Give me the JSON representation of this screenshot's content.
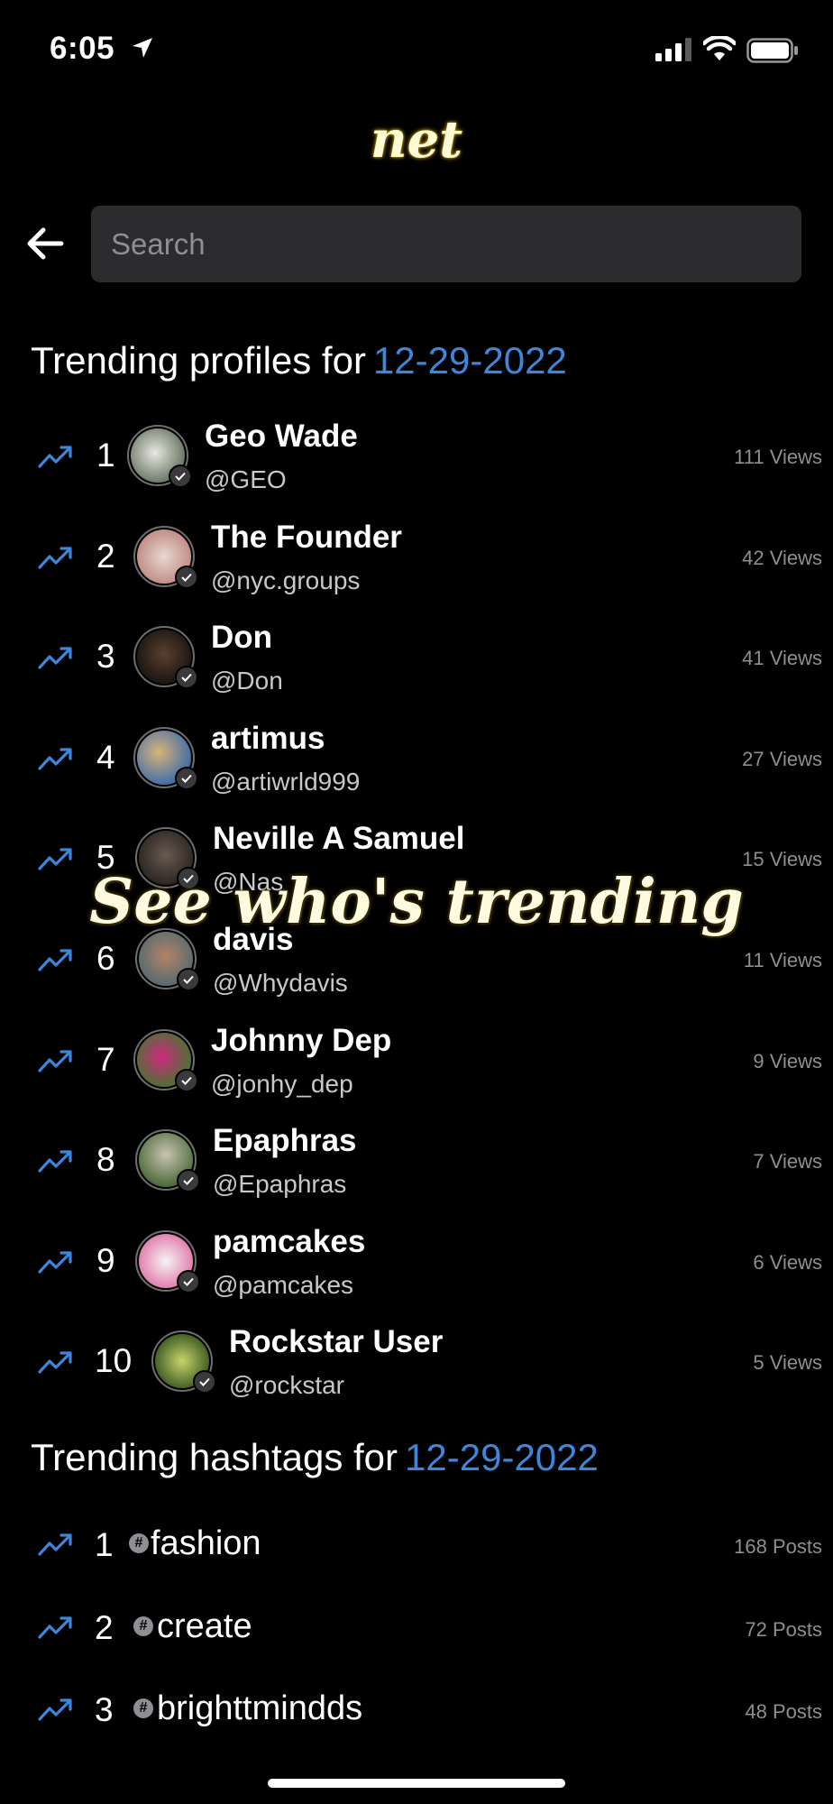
{
  "status": {
    "time": "6:05"
  },
  "app": {
    "title": "net"
  },
  "search": {
    "placeholder": "Search"
  },
  "profiles": {
    "heading": "Trending profiles for",
    "date": "12-29-2022",
    "items": [
      {
        "rank": "1",
        "name": "Geo Wade",
        "handle": "@GEO",
        "views": "111 Views"
      },
      {
        "rank": "2",
        "name": "The Founder",
        "handle": "@nyc.groups",
        "views": "42 Views"
      },
      {
        "rank": "3",
        "name": "Don",
        "handle": "@Don",
        "views": "41 Views"
      },
      {
        "rank": "4",
        "name": "artimus",
        "handle": "@artiwrld999",
        "views": "27 Views"
      },
      {
        "rank": "5",
        "name": "Neville A Samuel",
        "handle": "@Nas",
        "views": "15 Views"
      },
      {
        "rank": "6",
        "name": "davis",
        "handle": "@Whydavis",
        "views": "11 Views"
      },
      {
        "rank": "7",
        "name": "Johnny Dep",
        "handle": "@jonhy_dep",
        "views": "9 Views"
      },
      {
        "rank": "8",
        "name": "Epaphras",
        "handle": "@Epaphras",
        "views": "7 Views"
      },
      {
        "rank": "9",
        "name": "pamcakes",
        "handle": "@pamcakes",
        "views": "6 Views"
      },
      {
        "rank": "10",
        "name": "Rockstar User",
        "handle": "@rockstar",
        "views": "5 Views"
      }
    ]
  },
  "hashtags": {
    "heading": "Trending hashtags for",
    "date": "12-29-2022",
    "items": [
      {
        "rank": "1",
        "tag": "fashion",
        "posts": "168 Posts"
      },
      {
        "rank": "2",
        "tag": "create",
        "posts": "72 Posts"
      },
      {
        "rank": "3",
        "tag": "brighttmindds",
        "posts": "48 Posts"
      }
    ]
  },
  "overlay": {
    "caption": "See who's trending"
  },
  "colors": {
    "accent": "#3d86d9",
    "background": "#000000",
    "title": "#fffbd6"
  }
}
